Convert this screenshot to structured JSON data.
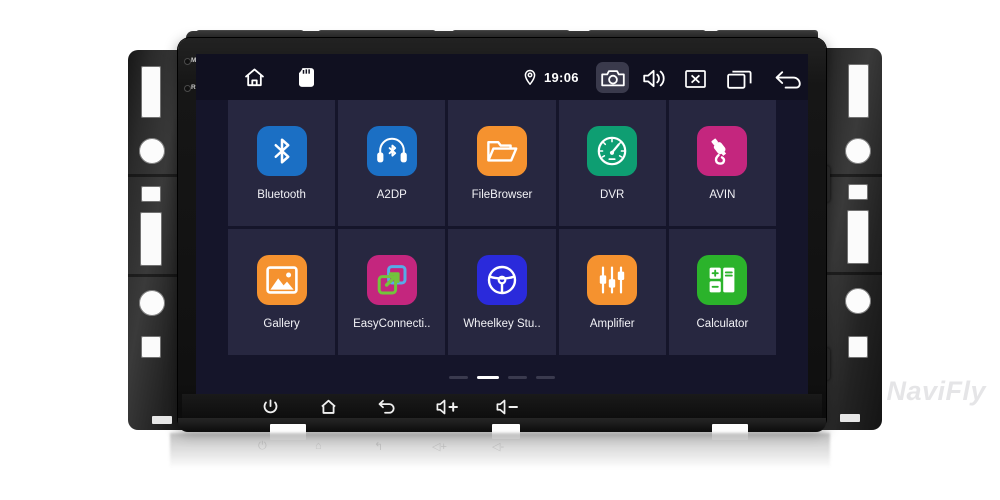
{
  "device": {
    "brand_watermark": "NaviFly",
    "bezel_labels": [
      "MIC",
      "RST"
    ]
  },
  "statusbar": {
    "home_icon": "home-icon",
    "sdcard_icon": "sd-card-icon",
    "location_icon": "location-pin-icon",
    "time": "19:06",
    "camera_icon": "camera-icon",
    "volume_icon": "speaker-volume-icon",
    "close_icon": "close-box-icon",
    "recents_icon": "recent-apps-icon",
    "back_icon": "back-arrow-icon"
  },
  "apps": [
    {
      "label": "Bluetooth",
      "icon": "bluetooth-icon",
      "color": "#1B6FC4"
    },
    {
      "label": "A2DP",
      "icon": "a2dp-headset-icon",
      "color": "#1B6FC4"
    },
    {
      "label": "FileBrowser",
      "icon": "folder-icon",
      "color": "#F5922F"
    },
    {
      "label": "DVR",
      "icon": "speedometer-icon",
      "color": "#0E9E72"
    },
    {
      "label": "AVIN",
      "icon": "audio-plug-icon",
      "color": "#C4267E"
    },
    {
      "label": "Gallery",
      "icon": "photo-icon",
      "color": "#F5922F"
    },
    {
      "label": "EasyConnecti..",
      "icon": "screen-mirror-icon",
      "color": "#C4267E"
    },
    {
      "label": "Wheelkey Stu..",
      "icon": "steering-wheel-icon",
      "color": "#2A2ADB"
    },
    {
      "label": "Amplifier",
      "icon": "equalizer-icon",
      "color": "#F5922F"
    },
    {
      "label": "Calculator",
      "icon": "calculator-icon",
      "color": "#2BB32B"
    }
  ],
  "pager": {
    "count": 4,
    "active_index": 1
  },
  "hardware_buttons": [
    {
      "name": "power-button",
      "icon": "power-icon"
    },
    {
      "name": "home-button",
      "icon": "home-icon"
    },
    {
      "name": "back-button",
      "icon": "back-arrow-icon"
    },
    {
      "name": "volume-up-button",
      "icon": "volume-up-icon"
    },
    {
      "name": "volume-down-button",
      "icon": "volume-down-icon"
    }
  ],
  "colors": {
    "screen_bg": "#15152a",
    "tile_bg": "#272740",
    "statusbar_bg": "#101020",
    "label_text": "#f2f2f6",
    "pager_active": "#ffffff",
    "pager_inactive": "#3a3a4e"
  }
}
